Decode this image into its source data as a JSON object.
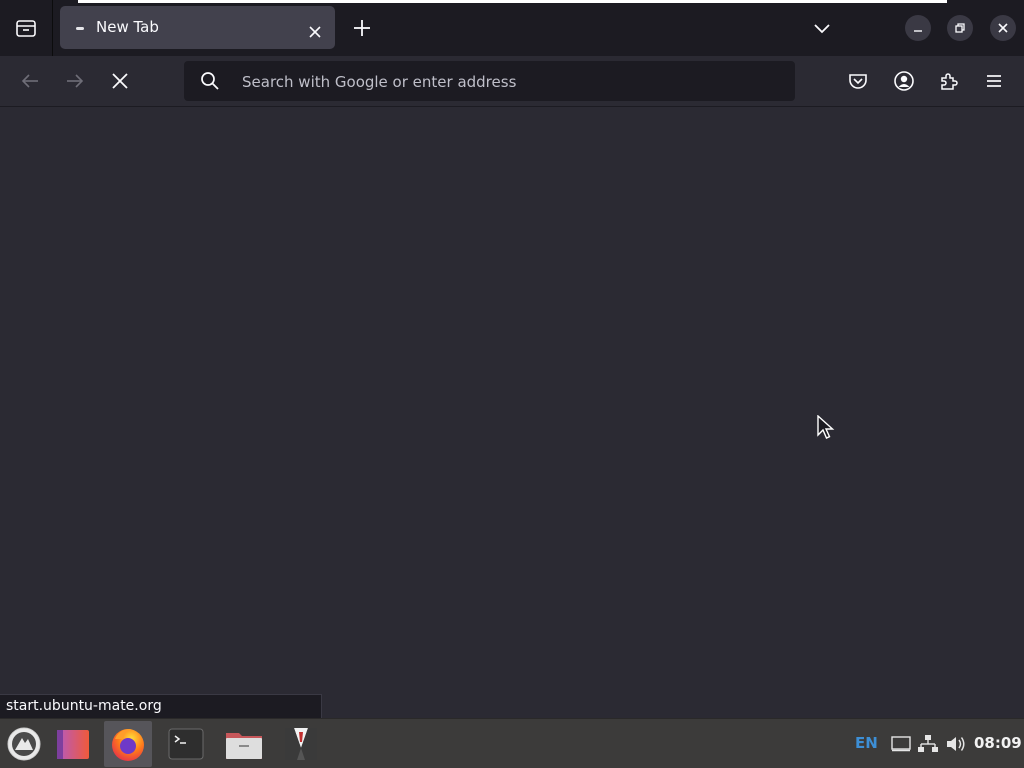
{
  "browser": {
    "tab": {
      "title": "New Tab"
    },
    "urlbar": {
      "placeholder": "Search with Google or enter address",
      "value": ""
    },
    "icons": {
      "tab_list": "tab-list-icon",
      "tab_close": "close-icon",
      "new_tab": "plus-icon",
      "all_tabs": "chevron-down-icon",
      "back": "arrow-left-icon",
      "forward": "arrow-right-icon",
      "stop": "stop-icon",
      "search": "search-icon",
      "pocket": "pocket-icon",
      "account": "account-icon",
      "extensions": "extensions-icon",
      "menu": "hamburger-menu-icon"
    }
  },
  "status_link": "start.ubuntu-mate.org",
  "taskbar": {
    "language": "EN",
    "clock": "08:09",
    "launchers": [
      "mate-menu",
      "software-boutique",
      "firefox",
      "terminal",
      "files",
      "mate-tweak"
    ]
  },
  "colors": {
    "accent": "#3d8fd6",
    "chrome_bg": "#1c1b22",
    "content_bg": "#2b2a33",
    "taskbar_bg": "#3c3b3a"
  }
}
